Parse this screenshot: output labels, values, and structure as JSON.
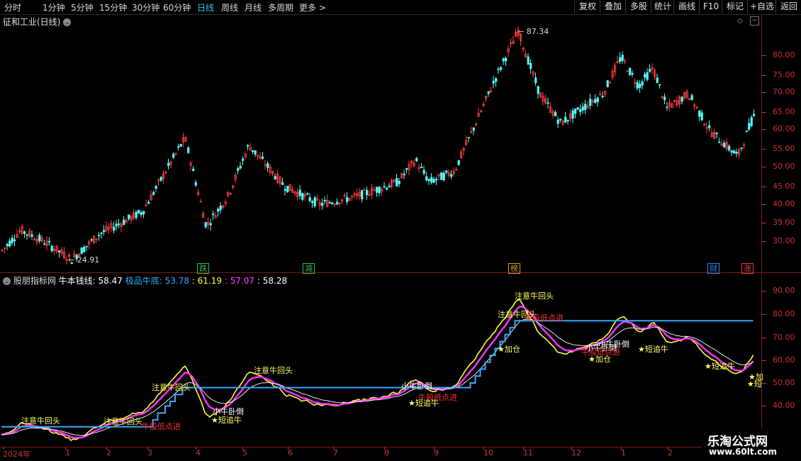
{
  "toolbar": {
    "timeframes": [
      "分时",
      "1分钟",
      "5分钟",
      "15分钟",
      "30分钟",
      "60分钟",
      "日线",
      "周线",
      "月线",
      "多周期",
      "更多 >"
    ],
    "active": "日线",
    "right_buttons": [
      "复权",
      "叠加",
      "多股",
      "统计",
      "画线",
      "F10",
      "标记",
      "+自选",
      "返回"
    ]
  },
  "main_panel": {
    "title": "征和工业(日线)",
    "high_label": "87.34",
    "low_label": "24.91",
    "y_axis": [
      "80.00",
      "75.00",
      "70.00",
      "65.00",
      "60.00",
      "55.00",
      "50.00",
      "45.00",
      "40.00",
      "35.00",
      "30.00"
    ],
    "event_badges": [
      {
        "text": "跌",
        "color": "#2fbf3f"
      },
      {
        "text": "减",
        "color": "#2fbf3f"
      },
      {
        "text": "榜",
        "color": "#d4a020"
      },
      {
        "text": "财",
        "color": "#2f7fff"
      },
      {
        "text": "涨",
        "color": "#e04040"
      }
    ]
  },
  "indicator_panel": {
    "source": "股朋指标网",
    "label1": "牛本钱线:",
    "value1": "58.47",
    "label2": "极品牛底:",
    "value2": "53.78",
    "value3": ": 61.19",
    "value4": ": 57.07",
    "value5": ": 58.28",
    "y_axis": [
      "90.00",
      "80.00",
      "70.00",
      "60.00",
      "50.00",
      "40.00"
    ],
    "annotations": [
      {
        "text": "注意牛回头",
        "color": "#ffff66"
      },
      {
        "text": "注意牛回头",
        "color": "#ffff66"
      },
      {
        "text": "注意牛回头",
        "color": "#ffff66"
      },
      {
        "text": "注意牛回头",
        "color": "#ffff66"
      },
      {
        "text": "注意牛回头",
        "color": "#ffff66"
      },
      {
        "text": "注意牛回头",
        "color": "#ffff66"
      },
      {
        "text": "小牛卧倒",
        "color": "#ffffff"
      },
      {
        "text": "小牛卧倒",
        "color": "#ffffff"
      },
      {
        "text": "小牛卧倒",
        "color": "#ffffff"
      },
      {
        "text": "小牛卧倒",
        "color": "#ffffff"
      },
      {
        "text": "牛股低点进",
        "color": "#ff3030"
      },
      {
        "text": "牛股低点进",
        "color": "#ff3030"
      },
      {
        "text": "牛股低点进",
        "color": "#ff3030"
      },
      {
        "text": "牛股低点进",
        "color": "#ff3030"
      },
      {
        "text": "★短追牛",
        "color": "#ffff66"
      },
      {
        "text": "★短追牛",
        "color": "#ffff66"
      },
      {
        "text": "★短追牛",
        "color": "#ffff66"
      },
      {
        "text": "★短追牛",
        "color": "#ffff66"
      },
      {
        "text": "★加仓",
        "color": "#ffff66"
      },
      {
        "text": "★加仓",
        "color": "#ffff66"
      },
      {
        "text": "★加",
        "color": "#ffff66"
      },
      {
        "text": "★短",
        "color": "#ffff66"
      }
    ]
  },
  "x_axis": [
    "2024年",
    "1",
    "2",
    "3",
    "4",
    "5",
    "6",
    "7",
    "8",
    "9",
    "10",
    "11",
    "12",
    "1",
    "2"
  ],
  "watermark": {
    "title": "乐淘公式网",
    "url": "www.60lt.com"
  },
  "colors": {
    "up": "#ff3b3b",
    "down": "#54ffff",
    "axis": "#cc3333",
    "yellow": "#ffff33",
    "magenta": "#ff33ff",
    "blue": "#33aaff",
    "white": "#ffffff"
  }
}
